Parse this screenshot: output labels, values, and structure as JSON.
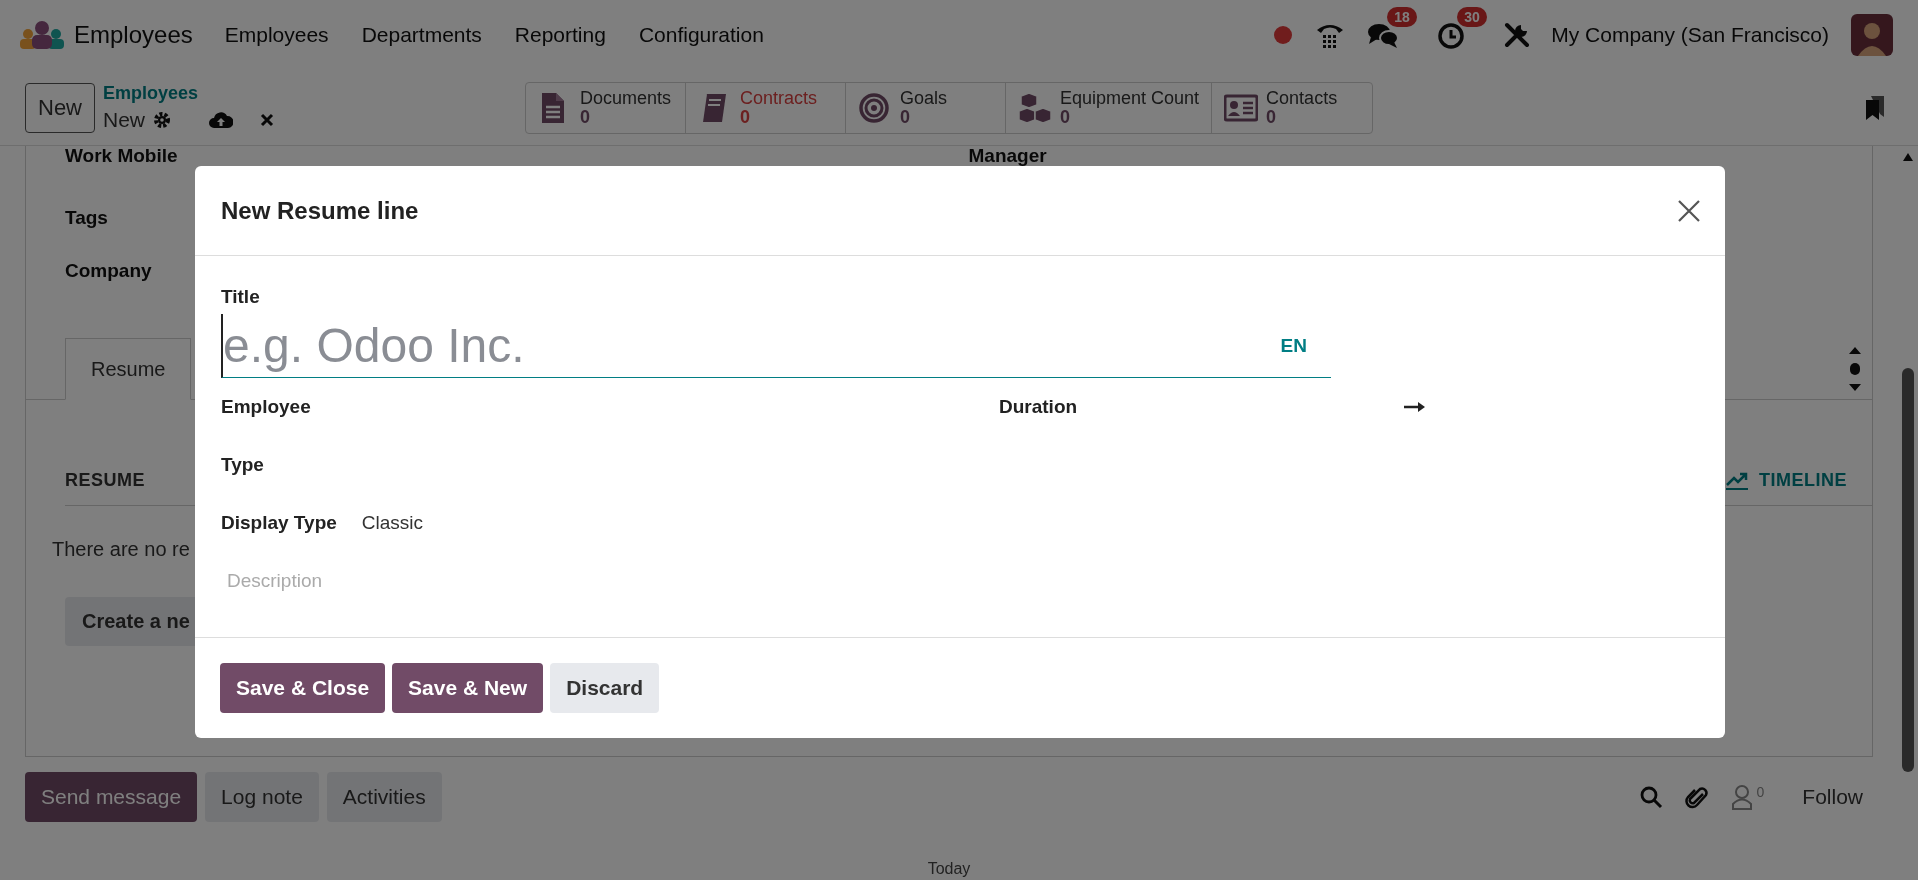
{
  "navbar": {
    "app_name": "Employees",
    "menu": [
      "Employees",
      "Departments",
      "Reporting",
      "Configuration"
    ],
    "systray": [
      {
        "kind": "record"
      },
      {
        "kind": "phone"
      },
      {
        "kind": "chat",
        "badge": "18"
      },
      {
        "kind": "activity",
        "badge": "30"
      },
      {
        "kind": "tools"
      }
    ],
    "company": "My Company (San Francisco)"
  },
  "control_panel": {
    "new_button": "New",
    "breadcrumb": "Employees",
    "record": "New",
    "smart_buttons": [
      {
        "kind": "document",
        "label": "Documents",
        "value": "0",
        "warning": false
      },
      {
        "kind": "book",
        "label": "Contracts",
        "value": "0",
        "warning": true
      },
      {
        "kind": "target",
        "label": "Goals",
        "value": "0",
        "warning": false
      },
      {
        "kind": "cubes",
        "label": "Equipment Count",
        "value": "0",
        "warning": false
      },
      {
        "kind": "card",
        "label": "Contacts",
        "value": "0",
        "warning": false
      }
    ]
  },
  "form": {
    "fields_left": [
      "Work Mobile",
      "Tags",
      "Company"
    ],
    "fields_right": [
      "Manager"
    ],
    "tabs": [
      {
        "label": "Resume",
        "selected": true
      }
    ],
    "resume_heading": "RESUME",
    "timeline_button": "TIMELINE",
    "empty_text": "There are no re",
    "create_button": "Create a ne"
  },
  "chatter": {
    "buttons": [
      {
        "label": "Send message",
        "selected": true
      },
      {
        "label": "Log note",
        "selected": false
      },
      {
        "label": "Activities",
        "selected": false
      }
    ],
    "followers_count": "0",
    "follow_button": "Follow",
    "date": "Today"
  },
  "dialog": {
    "title": "New Resume line",
    "title_label": "Title",
    "title_placeholder": "e.g. Odoo Inc.",
    "language": "EN",
    "employee_label": "Employee",
    "duration_label": "Duration",
    "type_label": "Type",
    "display_type_label": "Display Type",
    "display_type_value": "Classic",
    "description_placeholder": "Description",
    "buttons": [
      {
        "label": "Save & Close",
        "kind": "primary"
      },
      {
        "label": "Save & New",
        "kind": "primary"
      },
      {
        "label": "Discard",
        "kind": "secondary"
      }
    ]
  }
}
